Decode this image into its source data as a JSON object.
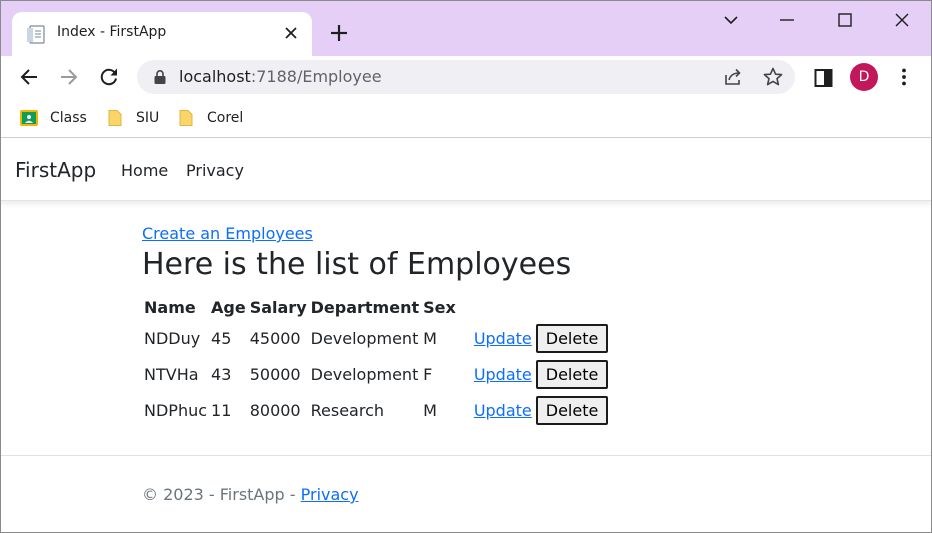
{
  "browser": {
    "tab_title": "Index - FirstApp",
    "url_host": "localhost",
    "url_path": ":7188/Employee",
    "profile_initial": "D",
    "accent_color": "#e6cff7",
    "bookmarks": [
      {
        "label": "Class",
        "icon": "google-classroom-icon"
      },
      {
        "label": "SIU",
        "icon": "folder-icon"
      },
      {
        "label": "Corel",
        "icon": "folder-icon"
      }
    ]
  },
  "navbar": {
    "brand": "FirstApp",
    "links": [
      "Home",
      "Privacy"
    ]
  },
  "main": {
    "create_link": "Create an Employees",
    "title": "Here is the list of Employees",
    "columns": [
      "Name",
      "Age",
      "Salary",
      "Department",
      "Sex"
    ],
    "rows": [
      {
        "name": "NDDuy",
        "age": "45",
        "salary": "45000",
        "department": "Development",
        "sex": "M"
      },
      {
        "name": "NTVHa",
        "age": "43",
        "salary": "50000",
        "department": "Development",
        "sex": "F"
      },
      {
        "name": "NDPhuc",
        "age": "11",
        "salary": "80000",
        "department": "Research",
        "sex": "M"
      }
    ],
    "update_label": "Update",
    "delete_label": "Delete"
  },
  "footer": {
    "text": "© 2023 - FirstApp - ",
    "privacy_link": "Privacy"
  }
}
